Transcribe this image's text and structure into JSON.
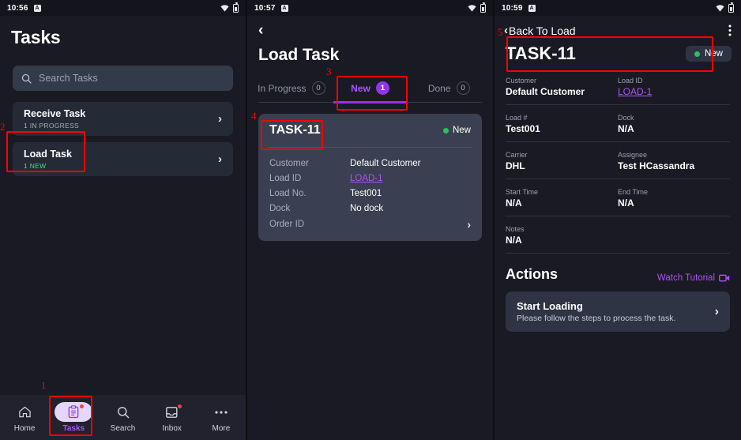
{
  "panel1": {
    "status": {
      "time": "10:56",
      "app_icon": "A",
      "wifi_icon": "wifi-icon",
      "battery_icon": "battery-icon"
    },
    "title": "Tasks",
    "search": {
      "placeholder": "Search Tasks",
      "icon": "search-icon"
    },
    "tasks": [
      {
        "name": "Receive Task",
        "sub": "1 IN PROGRESS",
        "sub_kind": "progress"
      },
      {
        "name": "Load Task",
        "sub": "1 NEW",
        "sub_kind": "new"
      }
    ],
    "nav": [
      {
        "label": "Home",
        "icon": "home-icon",
        "active": false,
        "badge": false
      },
      {
        "label": "Tasks",
        "icon": "clipboard-icon",
        "active": true,
        "badge": true
      },
      {
        "label": "Search",
        "icon": "search-icon",
        "active": false,
        "badge": false
      },
      {
        "label": "Inbox",
        "icon": "inbox-icon",
        "active": false,
        "badge": true
      },
      {
        "label": "More",
        "icon": "ellipsis-icon",
        "active": false,
        "badge": false
      }
    ]
  },
  "panel2": {
    "status": {
      "time": "10:57",
      "app_icon": "A"
    },
    "back_icon": "back-chevron-icon",
    "title": "Load Task",
    "tabs": [
      {
        "label": "In Progress",
        "count": "0",
        "active": false
      },
      {
        "label": "New",
        "count": "1",
        "active": true
      },
      {
        "label": "Done",
        "count": "0",
        "active": false
      }
    ],
    "card": {
      "id": "TASK-11",
      "status": "New",
      "rows": [
        {
          "key": "Customer",
          "value": "Default Customer",
          "link": false
        },
        {
          "key": "Load ID",
          "value": "LOAD-1",
          "link": true
        },
        {
          "key": "Load No.",
          "value": "Test001",
          "link": false
        },
        {
          "key": "Dock",
          "value": "No dock",
          "link": false
        },
        {
          "key": "Order ID",
          "value": "",
          "link": false,
          "chevron": true
        }
      ]
    }
  },
  "panel3": {
    "status": {
      "time": "10:59",
      "app_icon": "A"
    },
    "back_label": "Back To Load",
    "menu_icon": "kebab-menu-icon",
    "title": "TASK-11",
    "status_badge": "New",
    "fields": [
      [
        {
          "key": "Customer",
          "value": "Default Customer",
          "link": false
        },
        {
          "key": "Load ID",
          "value": "LOAD-1",
          "link": true
        }
      ],
      [
        {
          "key": "Load #",
          "value": "Test001",
          "link": false
        },
        {
          "key": "Dock",
          "value": "N/A",
          "link": false
        }
      ],
      [
        {
          "key": "Carrier",
          "value": "DHL",
          "link": false
        },
        {
          "key": "Assignee",
          "value": "Test HCassandra",
          "link": false
        }
      ],
      [
        {
          "key": "Start Time",
          "value": "N/A",
          "link": false
        },
        {
          "key": "End Time",
          "value": "N/A",
          "link": false
        }
      ],
      [
        {
          "key": "Notes",
          "value": "N/A",
          "link": false
        }
      ]
    ],
    "actions": {
      "title": "Actions",
      "watch_label": "Watch Tutorial",
      "watch_icon": "video-camera-icon",
      "item": {
        "title": "Start Loading",
        "subtitle": "Please follow the steps to process the task."
      }
    }
  },
  "annotations": [
    {
      "num": "1"
    },
    {
      "num": "2"
    },
    {
      "num": "3"
    },
    {
      "num": "4"
    },
    {
      "num": "5"
    }
  ],
  "colors": {
    "accent": "#a855f7",
    "accent_strong": "#9333ea",
    "success": "#22c55e",
    "danger": "#ef4444",
    "annotation": "#ff0000"
  }
}
